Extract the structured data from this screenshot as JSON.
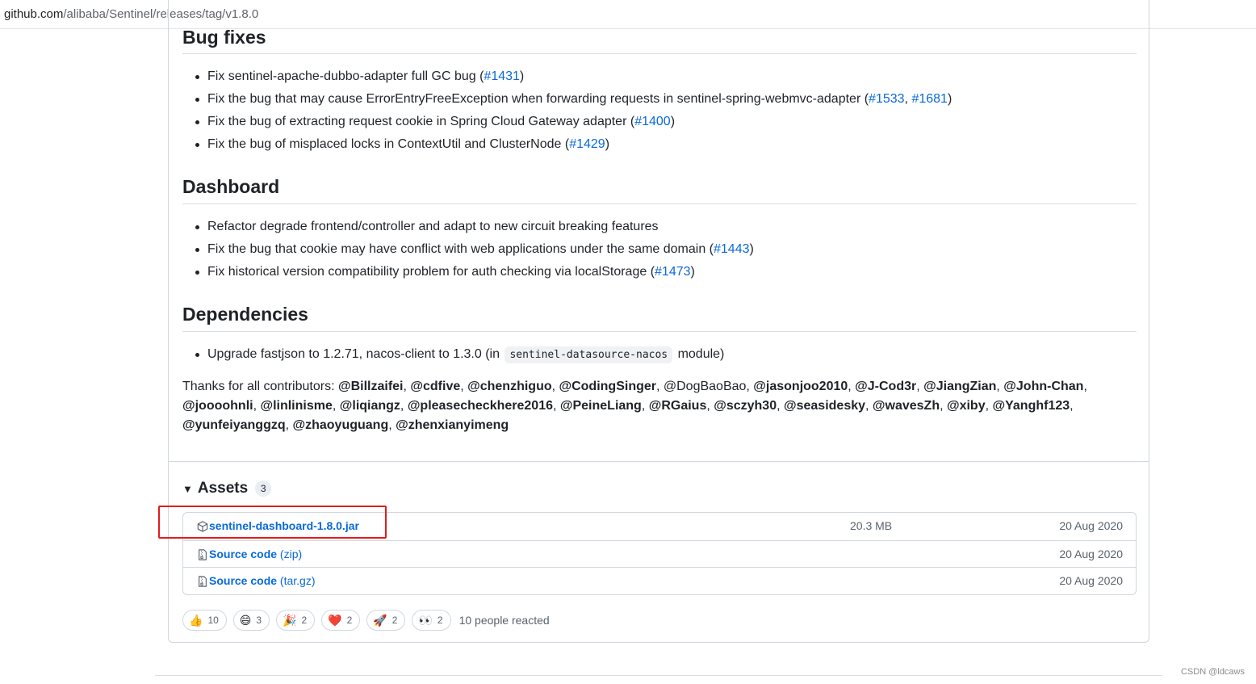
{
  "browser": {
    "url_host": "github.com",
    "url_path": "/alibaba/Sentinel/releases/tag/v1.8.0"
  },
  "sections": {
    "bugfixes": {
      "title": "Bug fixes",
      "items": [
        {
          "pre": "Fix sentinel-apache-dubbo-adapter full GC bug (",
          "l1": "#1431",
          "mid": "",
          "l2": "",
          "post": ")"
        },
        {
          "pre": "Fix the bug that may cause ErrorEntryFreeException when forwarding requests in sentinel-spring-webmvc-adapter (",
          "l1": "#1533",
          "mid": ", ",
          "l2": "#1681",
          "post": ")"
        },
        {
          "pre": "Fix the bug of extracting request cookie in Spring Cloud Gateway adapter (",
          "l1": "#1400",
          "mid": "",
          "l2": "",
          "post": ")"
        },
        {
          "pre": "Fix the bug of misplaced locks in ContextUtil and ClusterNode (",
          "l1": "#1429",
          "mid": "",
          "l2": "",
          "post": ")"
        }
      ]
    },
    "dashboard": {
      "title": "Dashboard",
      "items": [
        {
          "pre": "Refactor degrade frontend/controller and adapt to new circuit breaking features",
          "l1": "",
          "post": ""
        },
        {
          "pre": "Fix the bug that cookie may have conflict with web applications under the same domain (",
          "l1": "#1443",
          "post": ")"
        },
        {
          "pre": "Fix historical version compatibility problem for auth checking via localStorage (",
          "l1": "#1473",
          "post": ")"
        }
      ]
    },
    "dependencies": {
      "title": "Dependencies",
      "item": {
        "pre": "Upgrade fastjson to 1.2.71, nacos-client to 1.3.0 (in",
        "code": "sentinel-datasource-nacos",
        "post": "module)"
      }
    }
  },
  "thanks": {
    "label": "Thanks for all contributors:",
    "users": [
      "@Billzaifei",
      "@cdfive",
      "@chenzhiguo",
      "@CodingSinger",
      "@DogBaoBao",
      "@jasonjoo2010",
      "@J-Cod3r",
      "@JiangZian",
      "@John-Chan",
      "@joooohnli",
      "@linlinisme",
      "@liqiangz",
      "@pleasecheckhere2016",
      "@PeineLiang",
      "@RGaius",
      "@sczyh30",
      "@seasidesky",
      "@wavesZh",
      "@xiby",
      "@Yanghf123",
      "@yunfeiyanggzq",
      "@zhaoyuguang",
      "@zhenxianyimeng"
    ],
    "plain_users": [
      "@DogBaoBao"
    ]
  },
  "assets": {
    "title": "Assets",
    "count": "3",
    "rows": [
      {
        "name": "sentinel-dashboard-1.8.0.jar",
        "ext": "",
        "size": "20.3 MB",
        "date": "20 Aug 2020",
        "icon": "package-icon"
      },
      {
        "name": "Source code",
        "ext": "(zip)",
        "size": "",
        "date": "20 Aug 2020",
        "icon": "file-zip-icon"
      },
      {
        "name": "Source code",
        "ext": "(tar.gz)",
        "size": "",
        "date": "20 Aug 2020",
        "icon": "file-zip-icon"
      }
    ]
  },
  "reactions": {
    "items": [
      {
        "emoji": "👍",
        "count": "10",
        "name": "thumbs-up"
      },
      {
        "emoji": "😄",
        "count": "3",
        "name": "laugh"
      },
      {
        "emoji": "🎉",
        "count": "2",
        "name": "hooray"
      },
      {
        "emoji": "❤️",
        "count": "2",
        "name": "heart"
      },
      {
        "emoji": "🚀",
        "count": "2",
        "name": "rocket"
      },
      {
        "emoji": "👀",
        "count": "2",
        "name": "eyes"
      }
    ],
    "summary": "10 people reacted"
  },
  "watermark": "CSDN @ldcaws",
  "colors": {
    "link": "#0969da",
    "highlight": "#e11d1d",
    "border": "#d0d7de"
  }
}
